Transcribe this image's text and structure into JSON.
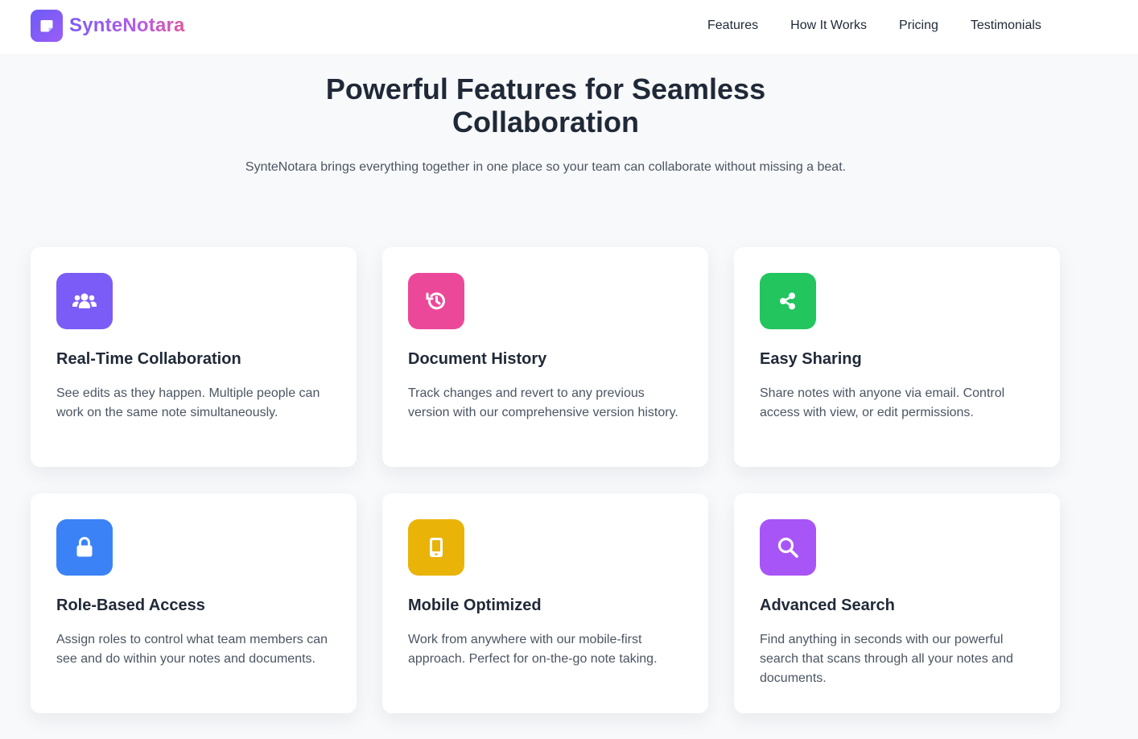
{
  "brand": {
    "name": "SynteNotara",
    "gradient_start": "#7c5cf6",
    "gradient_end": "#e0579d"
  },
  "nav": {
    "items": [
      {
        "label": "Features"
      },
      {
        "label": "How It Works"
      },
      {
        "label": "Pricing"
      },
      {
        "label": "Testimonials"
      }
    ]
  },
  "hero": {
    "title_line1": "Powerful Features for Seamless",
    "title_line2": "Collaboration",
    "subtitle": "SynteNotara brings everything together in one place so your team can collaborate without missing a beat."
  },
  "features": [
    {
      "icon": "users-icon",
      "color": "#7c5cf6",
      "title": "Real-Time Collaboration",
      "description": "See edits as they happen. Multiple people can work on the same note simultaneously."
    },
    {
      "icon": "history-icon",
      "color": "#ec4899",
      "title": "Document History",
      "description": "Track changes and revert to any previous version with our comprehensive version history."
    },
    {
      "icon": "share-icon",
      "color": "#22c55e",
      "title": "Easy Sharing",
      "description": "Share notes with anyone via email. Control access with view, or edit permissions."
    },
    {
      "icon": "lock-icon",
      "color": "#3b82f6",
      "title": "Role-Based Access",
      "description": "Assign roles to control what team members can see and do within your notes and documents."
    },
    {
      "icon": "mobile-icon",
      "color": "#eab308",
      "title": "Mobile Optimized",
      "description": "Work from anywhere with our mobile-first approach. Perfect for on-the-go note taking."
    },
    {
      "icon": "search-icon",
      "color": "#a855f7",
      "title": "Advanced Search",
      "description": "Find anything in seconds with our powerful search that scans through all your notes and documents."
    }
  ]
}
